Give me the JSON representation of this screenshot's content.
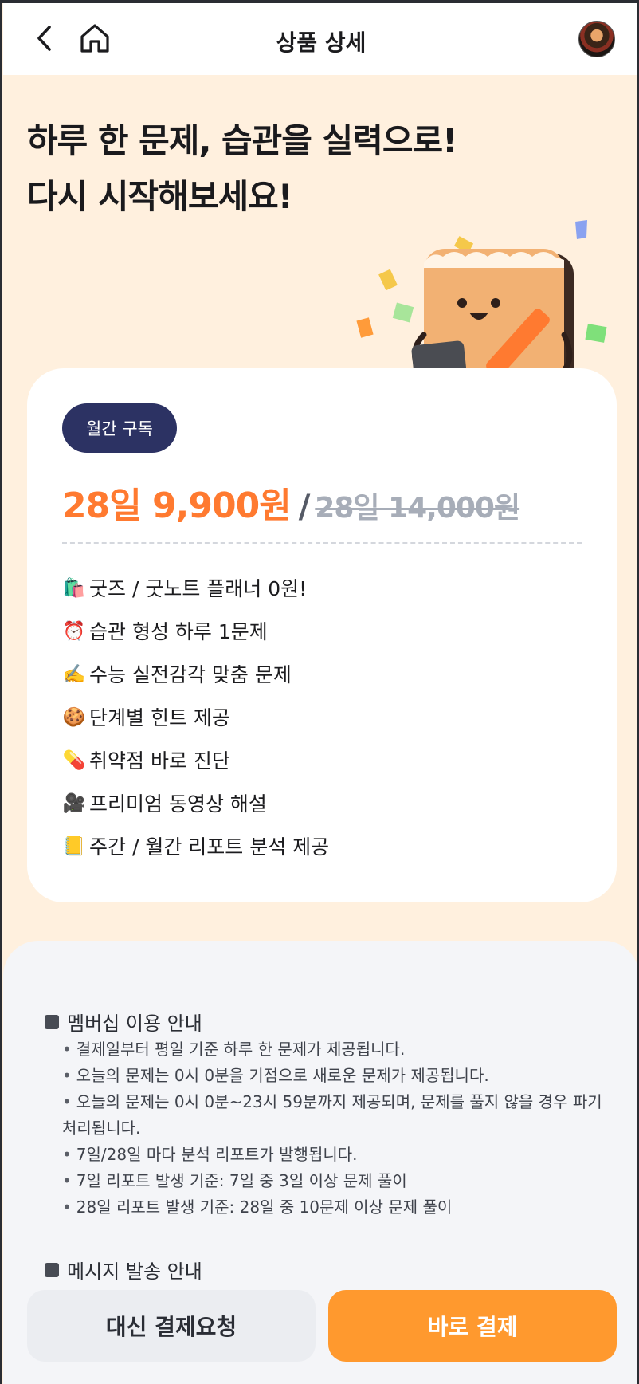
{
  "header": {
    "title": "상품 상세",
    "back_icon": "chevron-left-icon",
    "home_icon": "home-icon"
  },
  "hero": {
    "line1": "하루 한 문제, 습관을 실력으로!",
    "line2": "다시 시작해보세요!"
  },
  "plan": {
    "badge": "월간 구독",
    "price_now": "28일 9,900원",
    "separator": "/",
    "price_old": "28일 14,000원",
    "features": [
      {
        "icon": "🛍️",
        "label": "굿즈 / 굿노트 플래너 0원!"
      },
      {
        "icon": "⏰",
        "label": "습관 형성 하루 1문제"
      },
      {
        "icon": "✍️",
        "label": "수능 실전감각 맞춤 문제"
      },
      {
        "icon": "🍪",
        "label": "단계별 힌트 제공"
      },
      {
        "icon": "💊",
        "label": "취약점 바로 진단"
      },
      {
        "icon": "🎥",
        "label": "프리미엄 동영상 해설"
      },
      {
        "icon": "📒",
        "label": "주간 / 월간 리포트 분석 제공"
      }
    ]
  },
  "info": {
    "membership_title": "멤버십 이용 안내",
    "membership_notes": [
      "결제일부터 평일 기준 하루 한 문제가 제공됩니다.",
      "오늘의 문제는 0시 0분을 기점으로 새로운 문제가 제공됩니다.",
      "오늘의 문제는 0시 0분~23시 59분까지 제공되며, 문제를 풀지 않을 경우 파기 처리됩니다.",
      "7일/28일 마다 분석 리포트가 발행됩니다.",
      "7일 리포트 발생 기준: 7일 중 3일 이상 문제 풀이",
      "28일 리포트 발생 기준: 28일 중 10문제 이상 문제 풀이"
    ],
    "message_title": "메시지 발송 안내"
  },
  "actions": {
    "delegate_label": "대신 결제요청",
    "pay_label": "바로 결제"
  },
  "colors": {
    "accent_orange": "#ff7a30",
    "pay_button": "#ff992e",
    "badge_navy": "#2c3263",
    "page_bg": "#fff0de"
  }
}
